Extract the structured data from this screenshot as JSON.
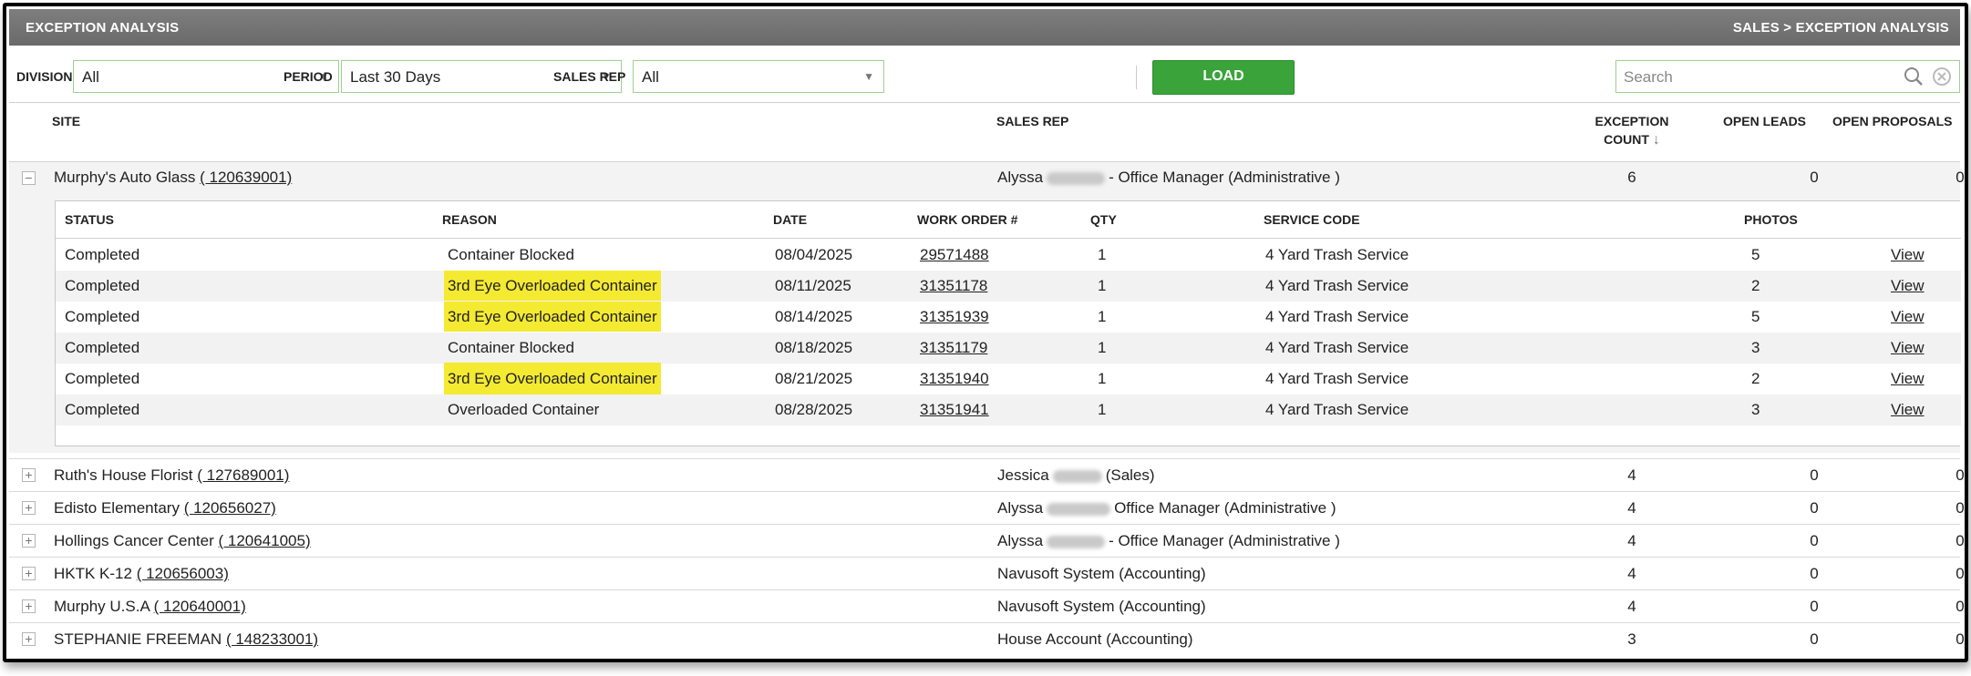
{
  "header": {
    "title": "EXCEPTION ANALYSIS",
    "breadcrumb": "SALES > EXCEPTION ANALYSIS"
  },
  "filters": {
    "division_label": "DIVISION",
    "division_value": "All",
    "period_label": "PERIOD",
    "period_value": "Last 30 Days",
    "sales_rep_label": "SALES REP",
    "sales_rep_value": "All",
    "load_label": "LOAD",
    "search_placeholder": "Search"
  },
  "columns": {
    "site": "SITE",
    "sales_rep": "SALES REP",
    "exception_count_1": "EXCEPTION",
    "exception_count_2": "COUNT",
    "open_leads": "OPEN LEADS",
    "open_proposals": "OPEN PROPOSALS"
  },
  "expanded_site": {
    "toggle": "−",
    "name": "Murphy's Auto Glass",
    "id": "( 120639001)",
    "rep_first": "Alyssa",
    "rep_suffix": "- Office Manager (Administrative )",
    "exception_count": "6",
    "open_leads": "0",
    "open_proposals": "0"
  },
  "sub_columns": {
    "status": "STATUS",
    "reason": "REASON",
    "date": "DATE",
    "work_order": "WORK ORDER #",
    "qty": "QTY",
    "service_code": "SERVICE CODE",
    "photos": "PHOTOS"
  },
  "sub_rows": [
    {
      "status": "Completed",
      "reason": "Container Blocked",
      "highlight": false,
      "date": "08/04/2025",
      "work_order": "29571488",
      "qty": "1",
      "service_code": "4 Yard Trash Service",
      "photos": "5",
      "view": "View"
    },
    {
      "status": "Completed",
      "reason": "3rd Eye Overloaded Container",
      "highlight": true,
      "date": "08/11/2025",
      "work_order": "31351178",
      "qty": "1",
      "service_code": "4 Yard Trash Service",
      "photos": "2",
      "view": "View"
    },
    {
      "status": "Completed",
      "reason": "3rd Eye Overloaded Container",
      "highlight": true,
      "date": "08/14/2025",
      "work_order": "31351939",
      "qty": "1",
      "service_code": "4 Yard Trash Service",
      "photos": "5",
      "view": "View"
    },
    {
      "status": "Completed",
      "reason": "Container Blocked",
      "highlight": false,
      "date": "08/18/2025",
      "work_order": "31351179",
      "qty": "1",
      "service_code": "4 Yard Trash Service",
      "photos": "3",
      "view": "View"
    },
    {
      "status": "Completed",
      "reason": "3rd Eye Overloaded Container",
      "highlight": true,
      "date": "08/21/2025",
      "work_order": "31351940",
      "qty": "1",
      "service_code": "4 Yard Trash Service",
      "photos": "2",
      "view": "View"
    },
    {
      "status": "Completed",
      "reason": "Overloaded Container",
      "highlight": false,
      "date": "08/28/2025",
      "work_order": "31351941",
      "qty": "1",
      "service_code": "4 Yard Trash Service",
      "photos": "3",
      "view": "View"
    }
  ],
  "sites": [
    {
      "toggle": "+",
      "name": "Ruth's House Florist",
      "id": "( 127689001)",
      "rep_first": "Jessica",
      "rep_suffix": "(Sales)",
      "rep_blur": true,
      "exception_count": "4",
      "open_leads": "0",
      "open_proposals": "0"
    },
    {
      "toggle": "+",
      "name": "Edisto Elementary",
      "id": "( 120656027)",
      "rep_first": "Alyssa",
      "rep_suffix": "Office Manager (Administrative )",
      "rep_blur": true,
      "exception_count": "4",
      "open_leads": "0",
      "open_proposals": "0"
    },
    {
      "toggle": "+",
      "name": "Hollings Cancer Center",
      "id": "( 120641005)",
      "rep_first": "Alyssa",
      "rep_suffix": "- Office Manager (Administrative )",
      "rep_blur": true,
      "exception_count": "4",
      "open_leads": "0",
      "open_proposals": "0"
    },
    {
      "toggle": "+",
      "name": "HKTK K-12",
      "id": "( 120656003)",
      "rep_first": "Navusoft System (Accounting)",
      "rep_suffix": "",
      "rep_blur": false,
      "exception_count": "4",
      "open_leads": "0",
      "open_proposals": "0"
    },
    {
      "toggle": "+",
      "name": "Murphy U.S.A",
      "id": "( 120640001)",
      "rep_first": "Navusoft System (Accounting)",
      "rep_suffix": "",
      "rep_blur": false,
      "exception_count": "4",
      "open_leads": "0",
      "open_proposals": "0"
    },
    {
      "toggle": "+",
      "name": "STEPHANIE FREEMAN",
      "id": "( 148233001)",
      "rep_first": "House Account (Accounting)",
      "rep_suffix": "",
      "rep_blur": false,
      "exception_count": "3",
      "open_leads": "0",
      "open_proposals": "0"
    }
  ],
  "colors": {
    "header_bg": "#6f6f6f",
    "load_button": "#3aa33a",
    "highlight": "#f4ea32",
    "field_border": "#9fd08f"
  },
  "icons": {
    "search": "search-icon",
    "clear": "clear-icon",
    "sort": "sort-down-arrow-icon",
    "collapse": "minus-icon",
    "expand": "plus-icon"
  }
}
